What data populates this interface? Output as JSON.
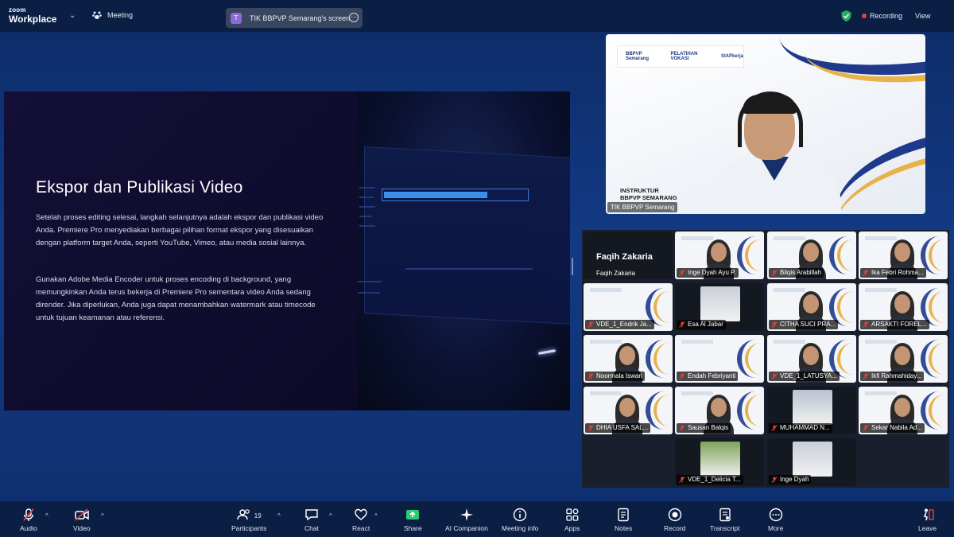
{
  "app": {
    "logo_line1": "zoom",
    "logo_line2": "Workplace",
    "meeting_label": "Meeting"
  },
  "share": {
    "title": "TIK BBPVP Semarang's screen",
    "badge": "T"
  },
  "status": {
    "recording": "Recording",
    "view": "View"
  },
  "slide": {
    "title": "Ekspor dan Publikasi Video",
    "paragraph1": "Setelah proses editing selesai, langkah selanjutnya adalah ekspor dan publikasi video Anda. Premiere Pro menyediakan berbagai pilihan format ekspor yang disesuaikan dengan platform target Anda, seperti YouTube, Vimeo, atau media sosial lainnya.",
    "paragraph2": "Gunakan Adobe Media Encoder untuk proses encoding di background, yang memungkinkan Anda terus bekerja di Premiere Pro sementara video Anda sedang dirender. Jika diperlukan, Anda juga dapat menambahkan watermark atau timecode untuk tujuan keamanan atau referensi."
  },
  "speaker": {
    "name": "TIK BBPVP Semarang",
    "caption_line1": "INSTRUKTUR",
    "caption_line2": "BBPVP SEMARANG",
    "logo1": "BBPVP Semarang",
    "logo2": "PELATIHAN VOKASI",
    "logo3": "SIAPkerja"
  },
  "participants": [
    {
      "name": "Faqih Zakaria",
      "style": "name-only"
    },
    {
      "name": "Inge Dyah Ayu P.",
      "style": "video"
    },
    {
      "name": "Bilqis Arabillah",
      "style": "video"
    },
    {
      "name": "Ika Febri Rohma...",
      "style": "video"
    },
    {
      "name": "VDE_1_Endrik Ja...",
      "style": "video-empty"
    },
    {
      "name": "Esa Al Jabar",
      "style": "dark"
    },
    {
      "name": "CITHA SUCI PRA...",
      "style": "video"
    },
    {
      "name": "ARSAKTI FOREL...",
      "style": "video"
    },
    {
      "name": "Noormala Iswari",
      "style": "video"
    },
    {
      "name": "Endah Febriyanti",
      "style": "video-empty"
    },
    {
      "name": "VDE_1_LATUSYA...",
      "style": "video"
    },
    {
      "name": "Ikfi Rahmahiday...",
      "style": "video"
    },
    {
      "name": "DHIA USFA SAL...",
      "style": "video"
    },
    {
      "name": "Sausan Balqis",
      "style": "video"
    },
    {
      "name": "MUHAMMAD N...",
      "style": "dark"
    },
    {
      "name": "Sekar Nabila Ad...",
      "style": "video"
    },
    {
      "name": "VDE_1_Delicia T...",
      "style": "dark"
    },
    {
      "name": "Inge Dyah",
      "style": "dark"
    }
  ],
  "toolbar": {
    "audio": "Audio",
    "video": "Video",
    "participants": "Participants",
    "participants_count": "19",
    "chat": "Chat",
    "react": "React",
    "share": "Share",
    "ai_companion": "AI Companion",
    "meeting_info": "Meeting info",
    "apps": "Apps",
    "notes": "Notes",
    "record": "Record",
    "transcript": "Transcript",
    "more": "More",
    "leave": "Leave"
  },
  "colors": {
    "accent": "#1f3a8a",
    "gold": "#e8b24a",
    "record_red": "#e24242",
    "share_green": "#2ecc71"
  }
}
